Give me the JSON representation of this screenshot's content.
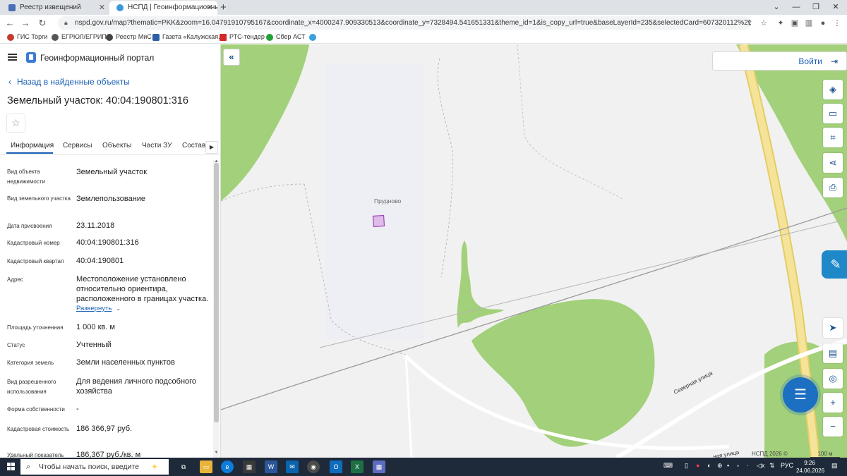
{
  "browser": {
    "tabs": [
      {
        "title": "Реестр извещений",
        "active": false
      },
      {
        "title": "НСПД | Геоинформационный п",
        "active": true
      }
    ],
    "new_tab": "+",
    "url": "nspd.gov.ru/map?thematic=PKK&zoom=16.04791910795167&coordinate_x=4000247.909330513&coordinate_y=7328494.541651331&theme_id=1&is_copy_url=true&baseLayerId=235&selectedCard=607320112%2C36368%2C40%3A04%3A190801%3A316",
    "bookmarks": [
      "ГИС Торги",
      "ЕГРЮЛ/ЕГРИП",
      "Реестр МиС",
      "Газета «Калужская...",
      "РТС-тендер",
      "Сбер АСТ"
    ]
  },
  "panel": {
    "portal_title": "Геоинформационный портал",
    "back_link": "Назад в найденные объекты",
    "object_title": "Земельный участок: 40:04:190801:316",
    "tabs": [
      "Информация",
      "Сервисы",
      "Объекты",
      "Части ЗУ",
      "Состав"
    ],
    "properties": [
      {
        "label": "Вид объекта недвижимости",
        "value": "Земельный участок"
      },
      {
        "label": "Вид земельного участка",
        "value": "Землепользование"
      },
      {
        "label": "Дата присвоения",
        "value": "23.11.2018"
      },
      {
        "label": "Кадастровый номер",
        "value": "40:04:190801:316"
      },
      {
        "label": "Кадастровый квартал",
        "value": "40:04:190801"
      },
      {
        "label": "Адрес",
        "value": "Местоположение установлено относительно ориентира, расположенного в границах участка."
      },
      {
        "label": "Площадь уточненная",
        "value": "1 000 кв. м"
      },
      {
        "label": "Статус",
        "value": "Учтенный"
      },
      {
        "label": "Категория земель",
        "value": "Земли населенных пунктов"
      },
      {
        "label": "Вид разрешенного использования",
        "value": "Для ведения личного подсобного хозяйства"
      },
      {
        "label": "Форма собственности",
        "value": "-"
      },
      {
        "label": "Кадастровая стоимость",
        "value": "186 366,97 руб."
      },
      {
        "label": "Удельный показатель",
        "value": "186,367 руб./кв. м"
      }
    ],
    "expand_link": "Развернуть"
  },
  "map": {
    "login": "Войти",
    "place_label": "Прудново",
    "street_labels": [
      "Северная улица",
      "ная улица"
    ],
    "copyright": "НСПД 2026 ©",
    "scale": "100 м",
    "colors": {
      "green": "#a3d07a",
      "water": "#b7d4f0",
      "road": "#f6e39a",
      "parcel": "#c88cd6",
      "background": "#f1f1f1"
    }
  },
  "taskbar": {
    "search_placeholder": "Чтобы начать поиск, введите",
    "language": "РУС",
    "time": "9:26",
    "date": "24.06.2026"
  }
}
